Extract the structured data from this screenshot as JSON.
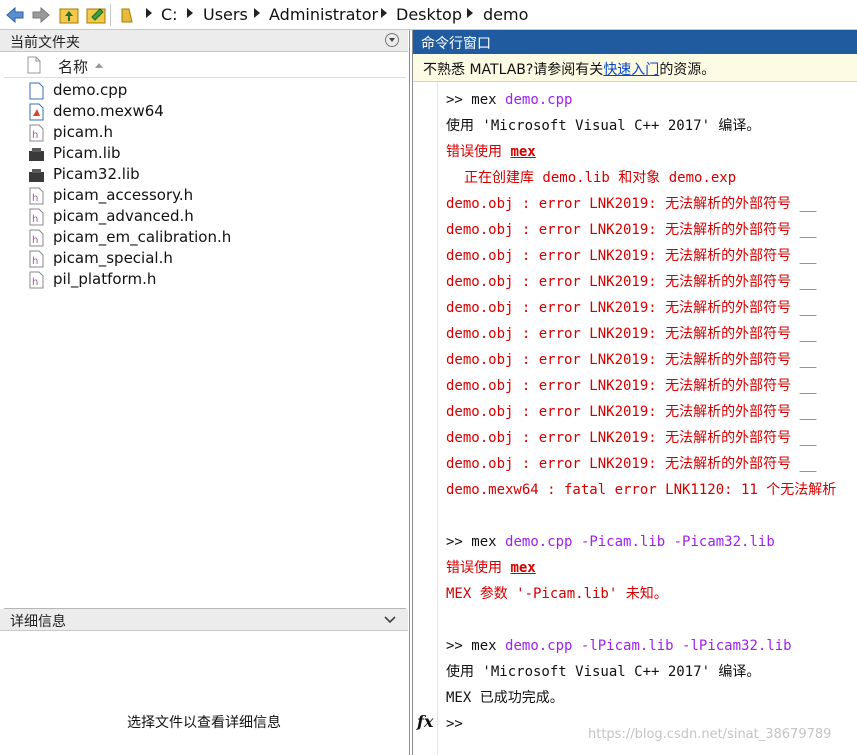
{
  "address_bar": {
    "path": [
      "C:",
      "Users",
      "Administrator",
      "Desktop",
      "demo"
    ]
  },
  "file_browser": {
    "title": "当前文件夹",
    "column_name": "名称",
    "files": [
      {
        "name": "demo.cpp",
        "icon": "cpp-file-icon"
      },
      {
        "name": "demo.mexw64",
        "icon": "mex-file-icon"
      },
      {
        "name": "picam.h",
        "icon": "header-file-icon"
      },
      {
        "name": "Picam.lib",
        "icon": "lib-file-icon"
      },
      {
        "name": "Picam32.lib",
        "icon": "lib-file-icon"
      },
      {
        "name": "picam_accessory.h",
        "icon": "header-file-icon"
      },
      {
        "name": "picam_advanced.h",
        "icon": "header-file-icon"
      },
      {
        "name": "picam_em_calibration.h",
        "icon": "header-file-icon"
      },
      {
        "name": "picam_special.h",
        "icon": "header-file-icon"
      },
      {
        "name": "pil_platform.h",
        "icon": "header-file-icon"
      }
    ]
  },
  "details": {
    "title": "详细信息",
    "empty_message": "选择文件以查看详细信息"
  },
  "command_window": {
    "title": "命令行窗口",
    "info_prefix": "不熟悉 MATLAB?请参阅有关",
    "info_link": "快速入门",
    "info_suffix": "的资源。",
    "prompt": ">>",
    "cmd1": {
      "mex": "mex",
      "args": "demo.cpp"
    },
    "compile_msg": "使用 'Microsoft Visual C++ 2017' 编译。",
    "error_prefix": "错误使用",
    "error_link": "mex",
    "creating_lib": "正在创建库 demo.lib 和对象 demo.exp",
    "lnk_errors": [
      "demo.obj : error LNK2019: 无法解析的外部符号 __",
      "demo.obj : error LNK2019: 无法解析的外部符号 __",
      "demo.obj : error LNK2019: 无法解析的外部符号 __",
      "demo.obj : error LNK2019: 无法解析的外部符号 __",
      "demo.obj : error LNK2019: 无法解析的外部符号 __",
      "demo.obj : error LNK2019: 无法解析的外部符号 __",
      "demo.obj : error LNK2019: 无法解析的外部符号 __",
      "demo.obj : error LNK2019: 无法解析的外部符号 __",
      "demo.obj : error LNK2019: 无法解析的外部符号 __",
      "demo.obj : error LNK2019: 无法解析的外部符号 __",
      "demo.obj : error LNK2019: 无法解析的外部符号 __"
    ],
    "fatal": "demo.mexw64 : fatal error LNK1120: 11 个无法解析",
    "cmd2": {
      "mex": "mex",
      "args": "demo.cpp -Picam.lib -Picam32.lib"
    },
    "unknown_param": "MEX 参数 '-Picam.lib' 未知。",
    "cmd3": {
      "mex": "mex",
      "args": "demo.cpp -lPicam.lib -lPicam32.lib"
    },
    "success": "MEX 已成功完成。",
    "fx": "fx"
  },
  "watermark": "https://blog.csdn.net/sinat_38679789",
  "colors": {
    "title_blue": "#1f5b9e",
    "error_red": "#d40000",
    "arg_purple": "#a020f0",
    "info_bg": "#fdfbe3"
  }
}
